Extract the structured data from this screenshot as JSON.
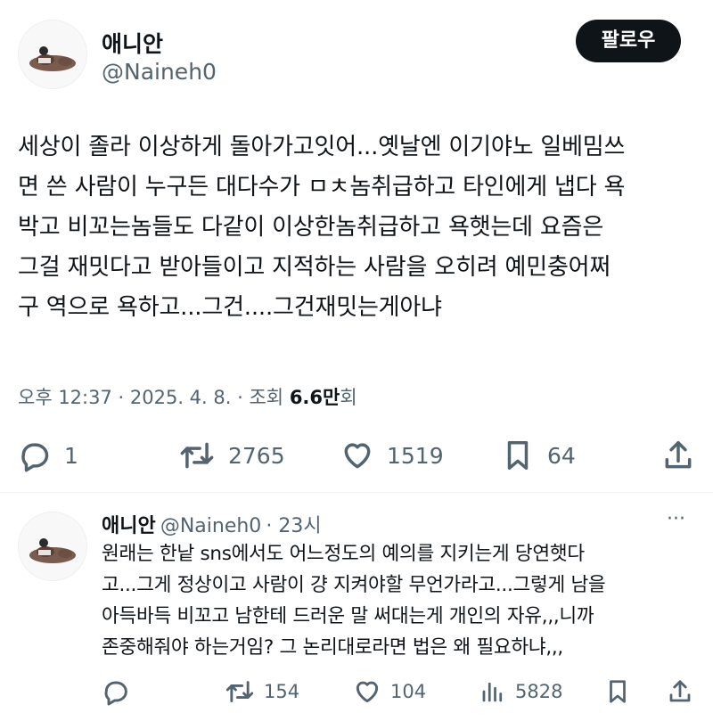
{
  "main_tweet": {
    "author_name": "애니안",
    "author_handle": "@Naineh0",
    "follow_label": "팔로우",
    "body_lines": [
      "세상이 졸라 이상하게 돌아가고잇어...옛날엔 이기야노 일베밈쓰",
      "면 쓴 사람이 누구든 대다수가 ㅁㅊ놈취급하고 타인에게 냅다 욕",
      "박고 비꼬는놈들도 다같이 이상한놈취급하고 욕햇는데 요즘은",
      "그걸 재밋다고 받아들이고 지적하는 사람을 오히려 예민충어쩌",
      "구 역으로 욕하고...그건....그건재밋는게아냐"
    ],
    "time": "오후 12:37",
    "date": "2025. 4. 8.",
    "views_label": "조회",
    "views_value": "6.6만",
    "views_unit": "회",
    "replies": "1",
    "reposts": "2765",
    "likes": "1519",
    "bookmarks": "64"
  },
  "reply_tweet": {
    "author_name": "애니안",
    "author_handle": "@Naineh0",
    "age": "23시",
    "more": "···",
    "body_lines": [
      "원래는 한낱 sns에서도 어느정도의 예의를 지키는게 당연햇다",
      "고...그게 정상이고 사람이 걍 지켜야할 무언가라고...그렇게 남을",
      "아득바득 비꼬고 남한테 드러운 말 써대는게 개인의 자유,,,니까",
      "존중해줘야 하는거임? 그 논리대로라면 법은 왜 필요하냐,,,"
    ],
    "replies": "",
    "reposts": "154",
    "likes": "104",
    "views": "5828"
  },
  "colors": {
    "text": "#0f1419",
    "muted": "#536471",
    "follow_bg": "#0f1419",
    "divider": "#eff3f4"
  },
  "icons": [
    "reply-icon",
    "repost-icon",
    "like-icon",
    "bookmark-icon",
    "share-icon",
    "views-icon",
    "more-icon"
  ]
}
